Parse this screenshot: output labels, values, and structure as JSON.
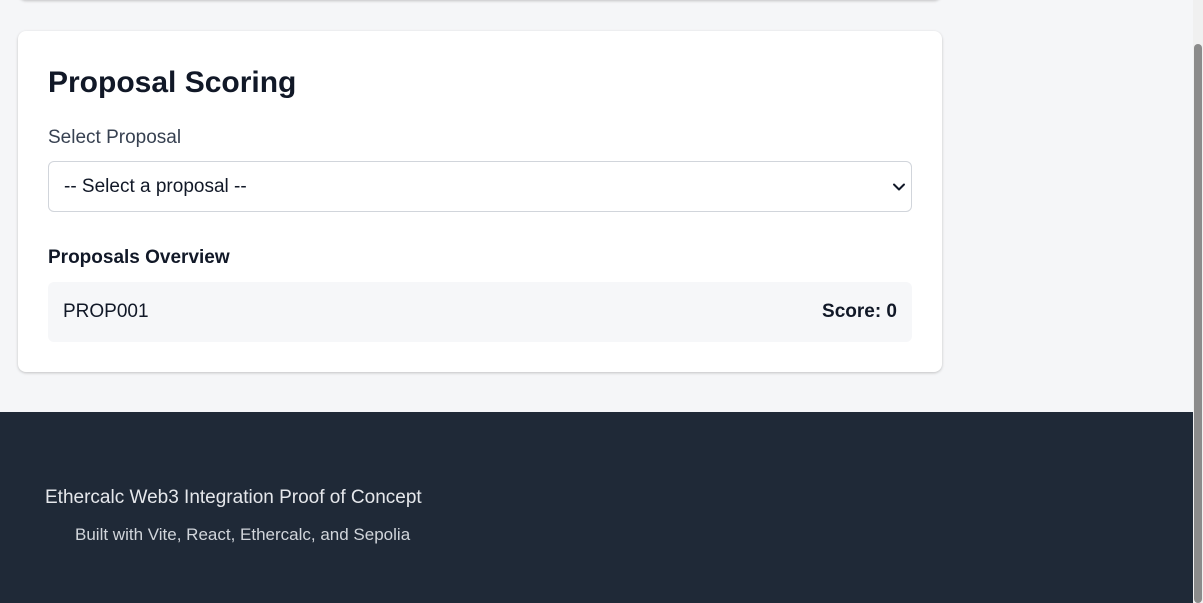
{
  "scoring": {
    "title": "Proposal Scoring",
    "select_label": "Select Proposal",
    "select_value": "-- Select a proposal --",
    "overview_title": "Proposals Overview",
    "proposals": [
      {
        "id": "PROP001",
        "score_text": "Score: 0"
      }
    ]
  },
  "footer": {
    "title": "Ethercalc Web3 Integration Proof of Concept",
    "subtitle": "Built with Vite, React, Ethercalc, and Sepolia"
  },
  "icons": {
    "select_chevron": "chevron-down-icon"
  },
  "colors": {
    "footer_bg": "#1f2937",
    "page_bg": "#f5f6f8",
    "card_bg": "#ffffff"
  }
}
